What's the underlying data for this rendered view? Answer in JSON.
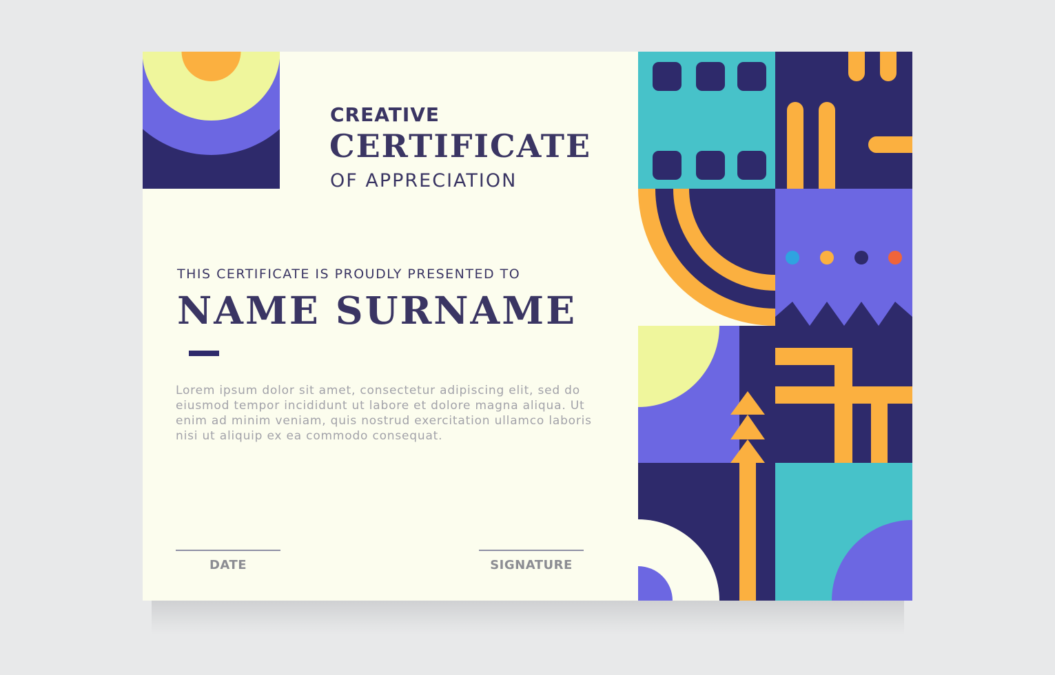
{
  "certificate": {
    "line1": "CREATIVE",
    "line2": "CERTIFICATE",
    "line3": "OF APPRECIATION",
    "presented_text": "THIS CERTIFICATE IS PROUDLY PRESENTED TO",
    "recipient_name": "NAME SURNAME",
    "body_lines": [
      "Lorem ipsum dolor sit amet, consectetur adipiscing elit, sed do",
      "eiusmod tempor incididunt ut labore et dolore magna aliqua. Ut",
      "enim ad minim veniam, quis nostrud exercitation ullamco laboris",
      "nisi ut aliquip ex ea commodo consequat."
    ],
    "date_label": "DATE",
    "signature_label": "SIGNATURE"
  },
  "colors": {
    "background": "#e8e9ea",
    "paper": "#fcfdee",
    "navy": "#2e2a6b",
    "purple": "#6c67e2",
    "teal": "#47c2c9",
    "orange": "#fbb040",
    "yellow": "#eff69c",
    "blue_dot": "#2fa3e0",
    "red_dot": "#f0643a"
  }
}
